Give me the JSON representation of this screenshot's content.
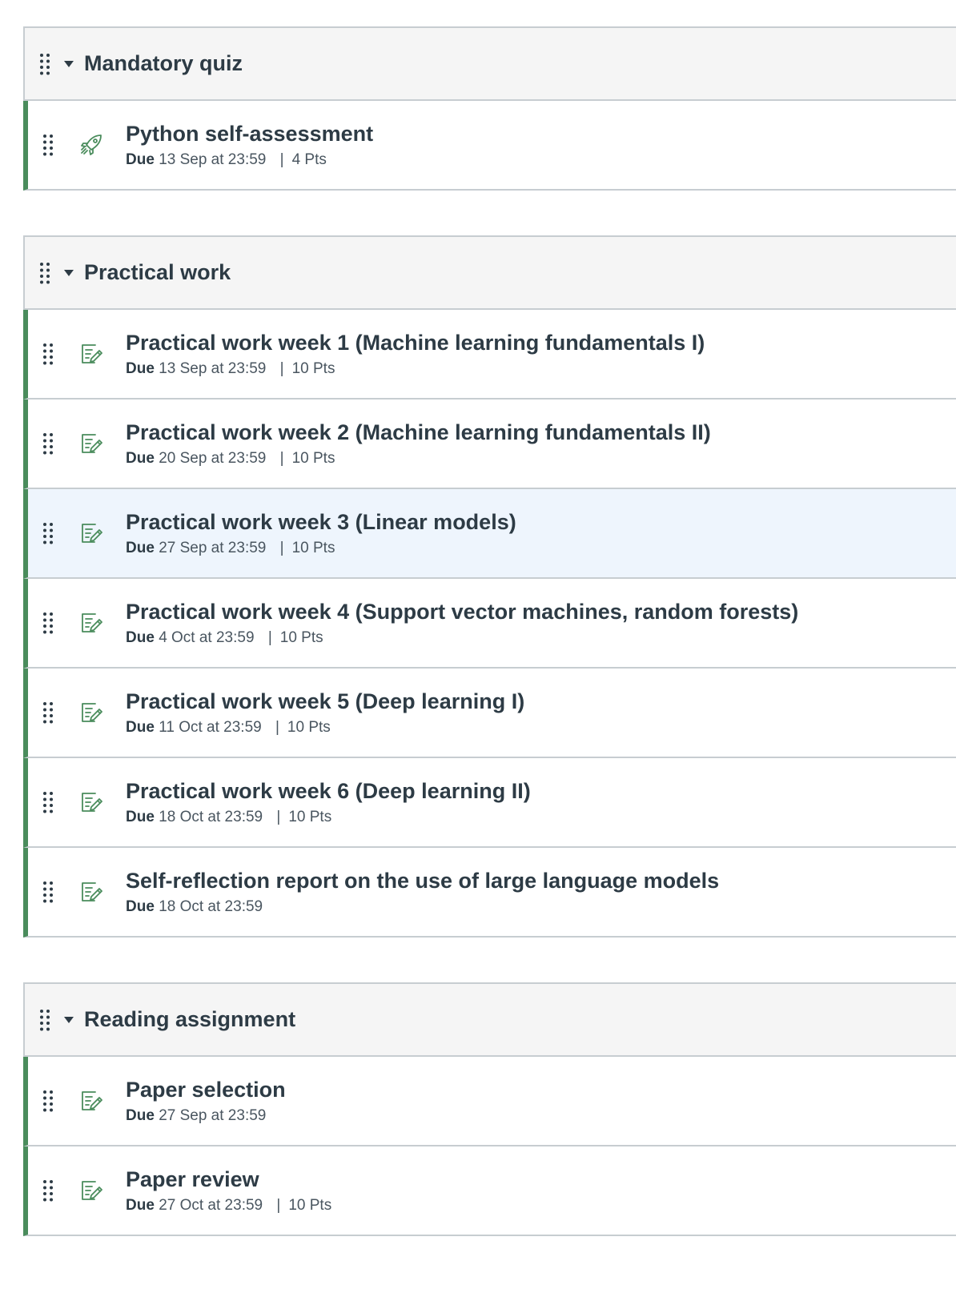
{
  "colors": {
    "accent_green": "#4a8c5c",
    "header_bg": "#f5f5f5",
    "highlight_bg": "#eef5fd",
    "border": "#c7cdd1"
  },
  "groups": [
    {
      "title": "Mandatory quiz",
      "items": [
        {
          "icon": "quiz-rocket-icon",
          "title": "Python self-assessment",
          "due_label": "Due",
          "due": "13 Sep at 23:59",
          "pts": "4 Pts"
        }
      ]
    },
    {
      "title": "Practical work",
      "items": [
        {
          "icon": "assignment-icon",
          "title": "Practical work week 1 (Machine learning fundamentals I)",
          "due_label": "Due",
          "due": "13 Sep at 23:59",
          "pts": "10 Pts"
        },
        {
          "icon": "assignment-icon",
          "title": "Practical work week 2 (Machine learning fundamentals II)",
          "due_label": "Due",
          "due": "20 Sep at 23:59",
          "pts": "10 Pts"
        },
        {
          "icon": "assignment-icon",
          "title": "Practical work week 3 (Linear models)",
          "due_label": "Due",
          "due": "27 Sep at 23:59",
          "pts": "10 Pts",
          "highlight": true
        },
        {
          "icon": "assignment-icon",
          "title": "Practical work week 4 (Support vector machines, random forests)",
          "due_label": "Due",
          "due": "4 Oct at 23:59",
          "pts": "10 Pts"
        },
        {
          "icon": "assignment-icon",
          "title": "Practical work week 5 (Deep learning I)",
          "due_label": "Due",
          "due": "11 Oct at 23:59",
          "pts": "10 Pts"
        },
        {
          "icon": "assignment-icon",
          "title": "Practical work week 6 (Deep learning II)",
          "due_label": "Due",
          "due": "18 Oct at 23:59",
          "pts": "10 Pts"
        },
        {
          "icon": "assignment-icon",
          "title": "Self-reflection report on the use of large language models",
          "due_label": "Due",
          "due": "18 Oct at 23:59",
          "pts": null
        }
      ]
    },
    {
      "title": "Reading assignment",
      "items": [
        {
          "icon": "assignment-icon",
          "title": "Paper selection",
          "due_label": "Due",
          "due": "27 Sep at 23:59",
          "pts": null
        },
        {
          "icon": "assignment-icon",
          "title": "Paper review",
          "due_label": "Due",
          "due": "27 Oct at 23:59",
          "pts": "10 Pts"
        }
      ]
    }
  ]
}
